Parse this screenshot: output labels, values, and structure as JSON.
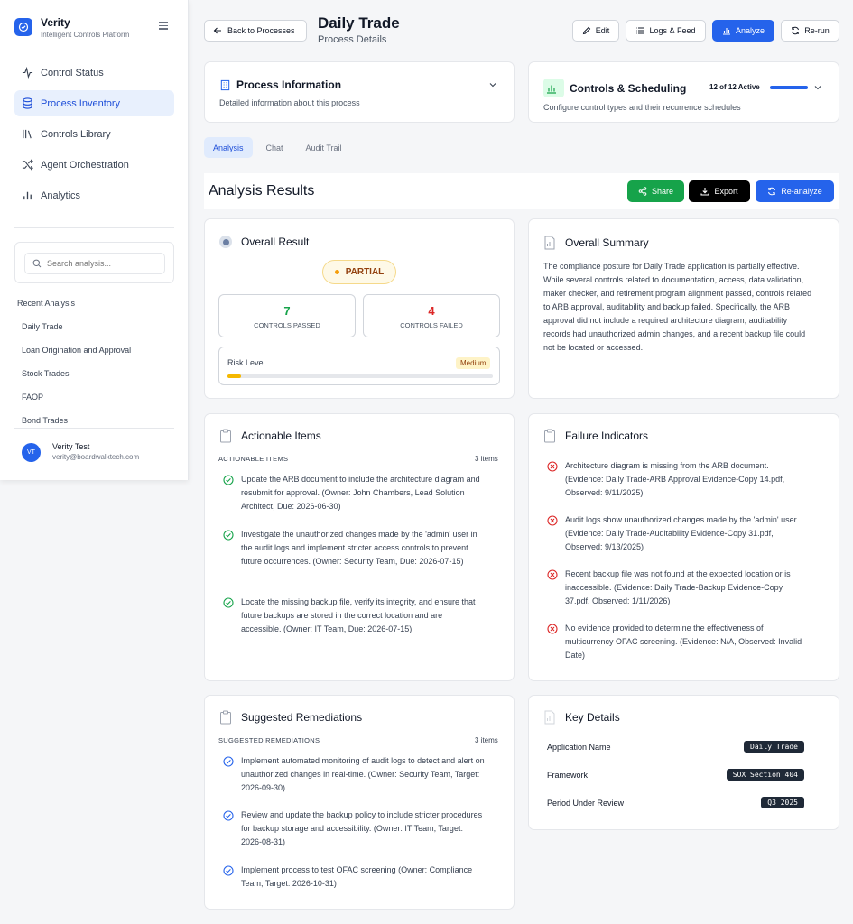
{
  "brand": {
    "title": "Verity",
    "subtitle": "Intelligent Controls Platform"
  },
  "nav": [
    {
      "label": "Control Status",
      "icon": "activity-icon"
    },
    {
      "label": "Process Inventory",
      "icon": "database-icon",
      "active": true
    },
    {
      "label": "Controls Library",
      "icon": "library-icon"
    },
    {
      "label": "Agent Orchestration",
      "icon": "shuffle-icon"
    },
    {
      "label": "Analytics",
      "icon": "bar-chart-icon"
    }
  ],
  "search": {
    "placeholder": "Search analysis..."
  },
  "recent": {
    "title": "Recent Analysis",
    "items": [
      "Daily Trade",
      "Loan Origination and Approval",
      "Stock Trades",
      "FAOP",
      "Bond Trades"
    ]
  },
  "user": {
    "initials": "VT",
    "name": "Verity Test",
    "email": "verity@boardwalktech.com"
  },
  "header": {
    "back_label": "Back to Processes",
    "title": "Daily Trade",
    "subtitle": "Process Details",
    "edit_label": "Edit",
    "logs_label": "Logs & Feed",
    "analyze_label": "Analyze",
    "rerun_label": "Re-run"
  },
  "process_info": {
    "title": "Process Information",
    "subtitle": "Detailed information about this process"
  },
  "controls": {
    "title": "Controls & Scheduling",
    "active": "12 of 12 Active",
    "active_fraction": 1.0,
    "subtitle": "Configure control types and their recurrence schedules"
  },
  "tabs": [
    "Analysis",
    "Chat",
    "Audit Trail"
  ],
  "results": {
    "title": "Analysis Results",
    "share_label": "Share",
    "export_label": "Export",
    "reanalyze_label": "Re-analyze"
  },
  "overall": {
    "title": "Overall Result",
    "status": "PARTIAL",
    "passed": "7",
    "passed_label": "CONTROLS PASSED",
    "failed": "4",
    "failed_label": "CONTROLS FAILED",
    "risk_label": "Risk Level",
    "risk_value": "Medium",
    "risk_fraction": 0.05
  },
  "summary": {
    "title": "Overall Summary",
    "text": "The compliance posture for Daily Trade application is partially effective. While several controls related to documentation, access, data validation, maker checker, and retirement program alignment passed, controls related to ARB approval, auditability and backup failed. Specifically, the ARB approval did not include a required architecture diagram, auditability records had unauthorized admin changes, and a recent backup file could not be located or accessed."
  },
  "actionable": {
    "title": "Actionable Items",
    "caps": "ACTIONABLE ITEMS",
    "count": "3 items",
    "items": [
      "Update the ARB document to include the architecture diagram and resubmit for approval. (Owner: John Chambers, Lead Solution Architect, Due: 2026-06-30)",
      "Investigate the unauthorized changes made by the 'admin' user in the audit logs and implement stricter access controls to prevent future occurrences. (Owner: Security Team, Due: 2026-07-15)",
      "Locate the missing backup file, verify its integrity, and ensure that future backups are stored in the correct location and are accessible. (Owner: IT Team, Due: 2026-07-15)"
    ]
  },
  "failures": {
    "title": "Failure Indicators",
    "items": [
      "Architecture diagram is missing from the ARB document. (Evidence: Daily Trade-ARB Approval Evidence-Copy 14.pdf, Observed: 9/11/2025)",
      "Audit logs show unauthorized changes made by the 'admin' user. (Evidence: Daily Trade-Auditability Evidence-Copy 31.pdf, Observed: 9/13/2025)",
      "Recent backup file was not found at the expected location or is inaccessible. (Evidence: Daily Trade-Backup Evidence-Copy 37.pdf, Observed: 1/11/2026)",
      "No evidence provided to determine the effectiveness of multicurrency OFAC screening. (Evidence: N/A, Observed: Invalid Date)"
    ]
  },
  "remediations": {
    "title": "Suggested Remediations",
    "caps": "SUGGESTED REMEDIATIONS",
    "count": "3 items",
    "items": [
      "Implement automated monitoring of audit logs to detect and alert on unauthorized changes in real-time. (Owner: Security Team, Target: 2026-09-30)",
      "Review and update the backup policy to include stricter procedures for backup storage and accessibility. (Owner: IT Team, Target: 2026-08-31)",
      "Implement process to test OFAC screening (Owner: Compliance Team, Target: 2026-10-31)"
    ]
  },
  "key_details": {
    "title": "Key Details",
    "rows": [
      {
        "label": "Application Name",
        "value": "Daily Trade"
      },
      {
        "label": "Framework",
        "value": "SOX Section 404"
      },
      {
        "label": "Period Under Review",
        "value": "Q3 2025"
      }
    ]
  },
  "colors": {
    "accent": "#2563eb",
    "success": "#16a34a",
    "danger": "#dc2626",
    "warning": "#f59e0b"
  }
}
